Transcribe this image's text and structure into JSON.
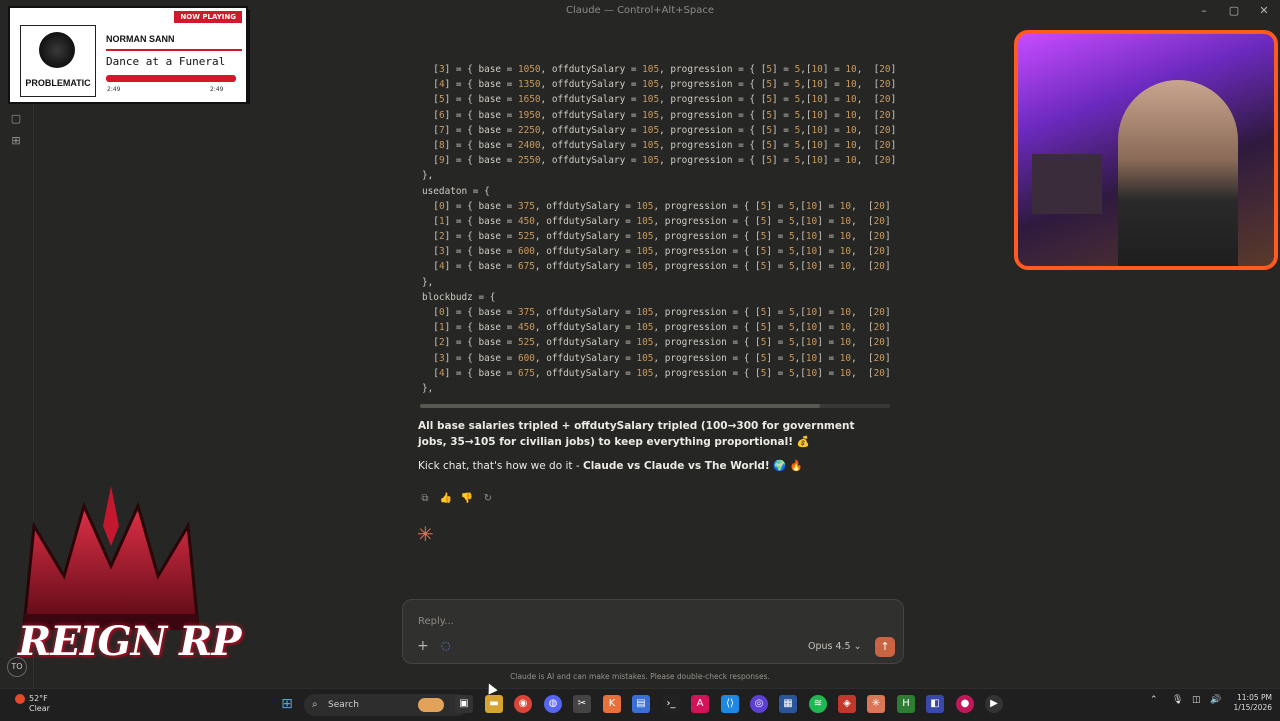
{
  "window": {
    "title": "Claude — Control+Alt+Space"
  },
  "now_playing": {
    "badge": "NOW PLAYING",
    "logo_text": "PROBLEMATIC",
    "artist": "NORMAN SANN",
    "song": "Dance at a Funeral",
    "elapsed": "2:49",
    "duration": "2:49",
    "progress_percent": 100
  },
  "overlay": {
    "brand_text": "REIGN RP",
    "badge": "TO"
  },
  "code_lines": [
    "  [3] = { base = 1050, offdutySalary = 105, progression = { [5] = 5,[10] = 10,  [20]",
    "  [4] = { base = 1350, offdutySalary = 105, progression = { [5] = 5,[10] = 10,  [20]",
    "  [5] = { base = 1650, offdutySalary = 105, progression = { [5] = 5,[10] = 10,  [20]",
    "  [6] = { base = 1950, offdutySalary = 105, progression = { [5] = 5,[10] = 10,  [20]",
    "  [7] = { base = 2250, offdutySalary = 105, progression = { [5] = 5,[10] = 10,  [20]",
    "  [8] = { base = 2400, offdutySalary = 105, progression = { [5] = 5,[10] = 10,  [20]",
    "  [9] = { base = 2550, offdutySalary = 105, progression = { [5] = 5,[10] = 10,  [20]",
    "},",
    "usedaton = {",
    "  [0] = { base = 375, offdutySalary = 105, progression = { [5] = 5,[10] = 10,  [20]",
    "  [1] = { base = 450, offdutySalary = 105, progression = { [5] = 5,[10] = 10,  [20]",
    "  [2] = { base = 525, offdutySalary = 105, progression = { [5] = 5,[10] = 10,  [20]",
    "  [3] = { base = 600, offdutySalary = 105, progression = { [5] = 5,[10] = 10,  [20]",
    "  [4] = { base = 675, offdutySalary = 105, progression = { [5] = 5,[10] = 10,  [20]",
    "},",
    "blockbudz = {",
    "  [0] = { base = 375, offdutySalary = 105, progression = { [5] = 5,[10] = 10,  [20]",
    "  [1] = { base = 450, offdutySalary = 105, progression = { [5] = 5,[10] = 10,  [20]",
    "  [2] = { base = 525, offdutySalary = 105, progression = { [5] = 5,[10] = 10,  [20]",
    "  [3] = { base = 600, offdutySalary = 105, progression = { [5] = 5,[10] = 10,  [20]",
    "  [4] = { base = 675, offdutySalary = 105, progression = { [5] = 5,[10] = 10,  [20]",
    "},"
  ],
  "message": {
    "line1": "All base salaries tripled + offdutySalary tripled (100→300 for government",
    "line2": "jobs, 35→105 for civilian jobs) to keep everything proportional! 💰",
    "line3_prefix": "Kick chat, that's how we do it - ",
    "line3_bold": "Claude vs Claude vs The World!",
    "line3_suffix": " 🌍 🔥"
  },
  "composer": {
    "placeholder": "Reply...",
    "model": "Opus 4.5",
    "disclaimer": "Claude is AI and can make mistakes. Please double-check responses."
  },
  "taskbar": {
    "weather_temp": "52°F",
    "weather_cond": "Clear",
    "search_label": "Search",
    "time": "11:05 PM",
    "date": "1/15/2026"
  },
  "colors": {
    "background": "#262624",
    "accent": "#c96442",
    "code_number": "#c99a5e",
    "spark": "#d97757",
    "camera_border": "#ff5a1f",
    "brand_red": "#d3182b"
  }
}
